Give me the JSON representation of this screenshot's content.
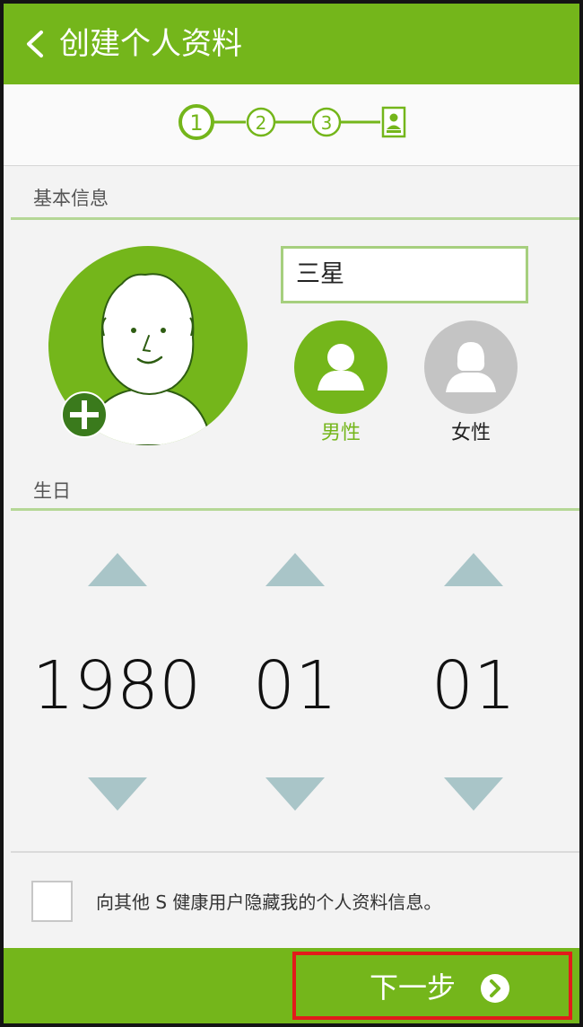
{
  "header": {
    "title": "创建个人资料",
    "back_icon": "back-chevron-icon"
  },
  "stepper": {
    "steps": [
      {
        "label": "1",
        "active": true
      },
      {
        "label": "2",
        "active": false
      },
      {
        "label": "3",
        "active": false
      },
      {
        "label": "",
        "icon": "profile-card-icon"
      }
    ]
  },
  "basic_info": {
    "section_label": "基本信息",
    "name_value": "三星",
    "add_photo_icon": "plus-icon",
    "gender": {
      "male_label": "男性",
      "female_label": "女性",
      "selected": "male"
    }
  },
  "birthday": {
    "section_label": "生日",
    "year": "1980",
    "month": "01",
    "day": "01"
  },
  "privacy": {
    "checked": false,
    "label": "向其他 S 健康用户隐藏我的个人资料信息。"
  },
  "footer": {
    "next_label": "下一步",
    "next_icon": "chevron-right-circle-icon"
  },
  "colors": {
    "brand_green": "#74b61b",
    "light_green": "#b5d796",
    "arrow": "#a9c5c8",
    "inactive_gray": "#c4c4c4",
    "highlight_red": "#e21b1b"
  }
}
